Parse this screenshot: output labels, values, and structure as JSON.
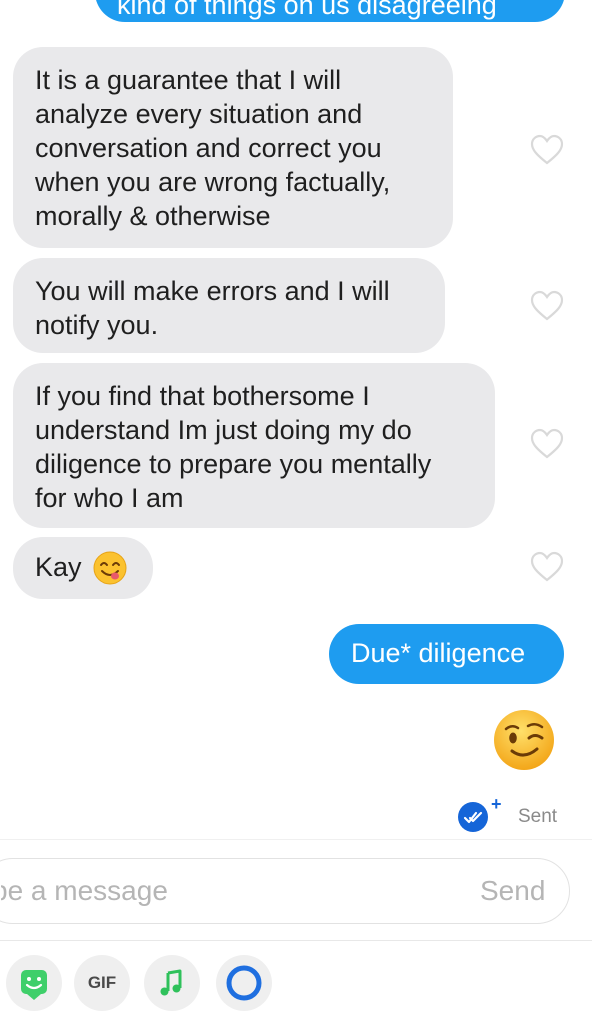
{
  "thread": {
    "top_outgoing_text": "kind of things on us disagreeing",
    "incoming": [
      {
        "lines": [
          "It is a guarantee that I will",
          "analyze every situation and",
          "conversation and correct you",
          "when you are wrong factually,",
          "morally & otherwise"
        ]
      },
      {
        "lines": [
          "You will make errors and I will",
          "notify you."
        ]
      },
      {
        "lines": [
          "If you find that bothersome I",
          "understand Im just doing my do",
          "diligence to prepare you mentally",
          "for who I am"
        ]
      },
      {
        "text": "Kay",
        "emoji": "face-savoring-food-emoji"
      }
    ],
    "outgoing_text": "Due* diligence",
    "outgoing_emoji": "winking-face-emoji",
    "status_label": "Sent"
  },
  "composer": {
    "placeholder": "pe a message",
    "send_label": "Send"
  },
  "toolbar": {
    "sticker_icon": "sticker-icon",
    "gif_label": "GIF",
    "music_icon": "music-note-icon",
    "circle_icon": "circle-icon"
  },
  "colors": {
    "outgoing_bubble": "#1e9cf0",
    "incoming_bubble": "#e9e9eb",
    "sent_badge": "#1565d8",
    "sticker_green": "#3fcf6a",
    "music_green": "#2fc15b",
    "circle_blue": "#1f6fe0"
  }
}
